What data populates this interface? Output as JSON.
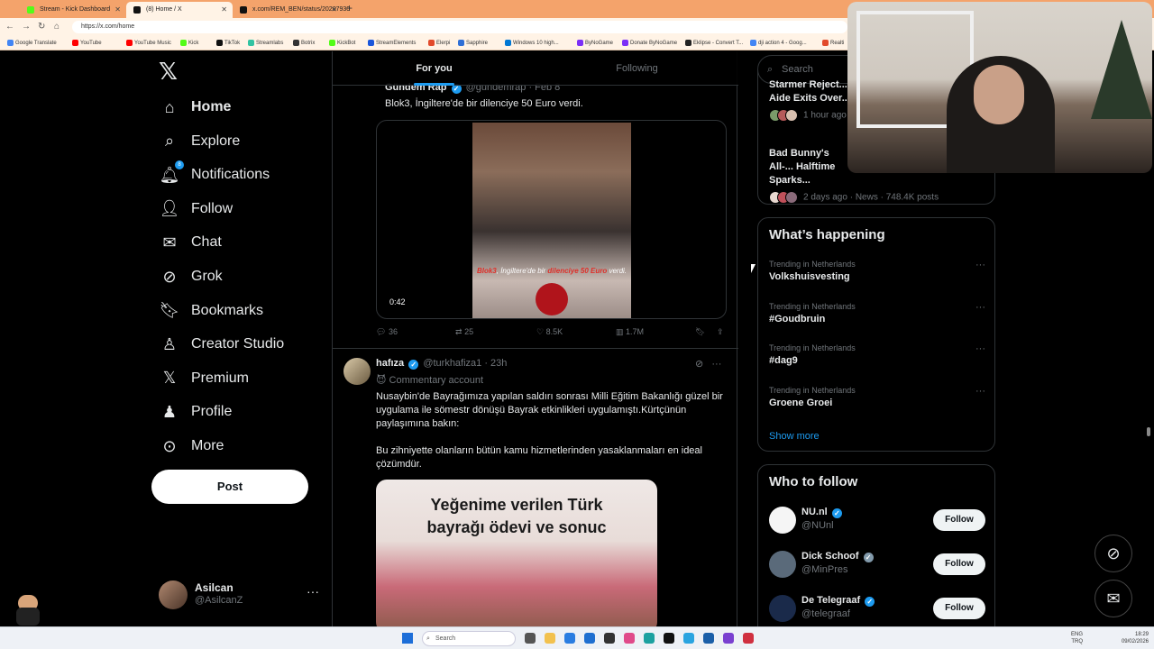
{
  "browser": {
    "tabs": [
      {
        "label": "Stream - Kick Dashboard",
        "color": "#53fc18"
      },
      {
        "label": "(8) Home / X",
        "color": "#111111"
      },
      {
        "label": "x.com/REM_BEN/status/20207930",
        "color": "#111111"
      }
    ],
    "url": "https://x.com/home",
    "bookmarks": [
      {
        "label": "Google Translate",
        "color": "#4285f4"
      },
      {
        "label": "YouTube",
        "color": "#ff0000"
      },
      {
        "label": "YouTube Music",
        "color": "#ff0000"
      },
      {
        "label": "Kick",
        "color": "#53fc18"
      },
      {
        "label": "TikTok",
        "color": "#111111"
      },
      {
        "label": "Streamlabs",
        "color": "#31c3a2"
      },
      {
        "label": "Botrix",
        "color": "#333333"
      },
      {
        "label": "KickBot",
        "color": "#53fc18"
      },
      {
        "label": "StreamElements",
        "color": "#1a56db"
      },
      {
        "label": "Elerpi",
        "color": "#e24a2b"
      },
      {
        "label": "Sapphire",
        "color": "#2f6fd6"
      },
      {
        "label": "Windows 10 high...",
        "color": "#0078d4"
      },
      {
        "label": "ByNoGame",
        "color": "#7b2ff7"
      },
      {
        "label": "Donate ByNoGame",
        "color": "#7b2ff7"
      },
      {
        "label": "Eklipse - Convert T...",
        "color": "#222222"
      },
      {
        "label": "dji action 4 - Goog...",
        "color": "#4285f4"
      },
      {
        "label": "Realti",
        "color": "#e24a2b"
      }
    ]
  },
  "nav": {
    "items": [
      {
        "label": "Home",
        "icon": "home-icon",
        "glyph": "⌂",
        "bold": true
      },
      {
        "label": "Explore",
        "icon": "search-icon",
        "glyph": "⌕"
      },
      {
        "label": "Notifications",
        "icon": "bell-icon",
        "glyph": "🔔︎",
        "badge": "8"
      },
      {
        "label": "Follow",
        "icon": "person-add-icon",
        "glyph": "👤︎"
      },
      {
        "label": "Chat",
        "icon": "mail-icon",
        "glyph": "✉"
      },
      {
        "label": "Grok",
        "icon": "grok-icon",
        "glyph": "⊘"
      },
      {
        "label": "Bookmarks",
        "icon": "bookmark-icon",
        "glyph": "🔖︎"
      },
      {
        "label": "Creator Studio",
        "icon": "creator-studio-icon",
        "glyph": "♙"
      },
      {
        "label": "Premium",
        "icon": "x-premium-icon",
        "glyph": "𝕏"
      },
      {
        "label": "Profile",
        "icon": "profile-icon",
        "glyph": "♟"
      },
      {
        "label": "More",
        "icon": "more-circle-icon",
        "glyph": "⊙"
      }
    ],
    "post_label": "Post",
    "account": {
      "name": "Asilcan",
      "handle": "@AsilcanZ",
      "more": "···"
    }
  },
  "feed": {
    "tabs": {
      "for_you": "For you",
      "following": "Following"
    },
    "quote": {
      "author": "Gündem Rap",
      "handle": "@gundemrap · Feb 8",
      "text": "Blok3, İngiltere'de bir dilenciye 50 Euro verdi.",
      "video_caption_a": "Blok3",
      "video_caption_b": ", İngiltere'de bir ",
      "video_caption_c": "dilenciye 50 Euro",
      "video_caption_d": " verdi.",
      "duration": "0:42"
    },
    "actions": {
      "replies": "36",
      "reposts": "25",
      "likes": "8.5K",
      "views": "1.7M"
    },
    "post2": {
      "author": "hafıza",
      "handle": "@turkhafiza1 · 23h",
      "label": "Commentary account",
      "text1": "Nusaybin'de Bayrağımıza yapılan saldırı sonrası Milli Eğitim Bakanlığı güzel bir uygulama ile sömestr dönüşü Bayrak etkinlikleri uygulamıştı.Kürtçünün paylaşımına bakın:",
      "text2": "Bu zihniyette olanların bütün kamu hizmetlerinden yasaklanmaları en ideal çözümdür.",
      "image_title_1": "Yeğenime verilen Türk",
      "image_title_2": "bayrağı ödevi ve sonuc"
    }
  },
  "sidebar": {
    "search_placeholder": "Search",
    "news": [
      {
        "title": "Starmer Reject... Aide Exits Over...",
        "meta": "1 hour ago"
      },
      {
        "title": "Bad Bunny's All-... Halftime Sparks...",
        "meta": "2 days ago · News · 748.4K posts"
      }
    ],
    "happening": {
      "title": "What’s happening",
      "trends": [
        {
          "context": "Trending in Netherlands",
          "name": "Volkshuisvesting"
        },
        {
          "context": "Trending in Netherlands",
          "name": "#Goudbruin"
        },
        {
          "context": "Trending in Netherlands",
          "name": "#dag9"
        },
        {
          "context": "Trending in Netherlands",
          "name": "Groene Groei"
        }
      ],
      "show_more": "Show more"
    },
    "who_to_follow": {
      "title": "Who to follow",
      "accounts": [
        {
          "name": "NU.nl",
          "handle": "@NUnl",
          "button": "Follow",
          "badge": "blue"
        },
        {
          "name": "Dick Schoof",
          "handle": "@MinPres",
          "button": "Follow",
          "badge": "grey"
        },
        {
          "name": "De Telegraaf",
          "handle": "@telegraaf",
          "button": "Follow",
          "badge": "blue"
        }
      ]
    }
  },
  "taskbar": {
    "search": "Search",
    "lang": "ENG",
    "region": "TRQ",
    "time": "18:29",
    "date": "09/02/2026"
  }
}
